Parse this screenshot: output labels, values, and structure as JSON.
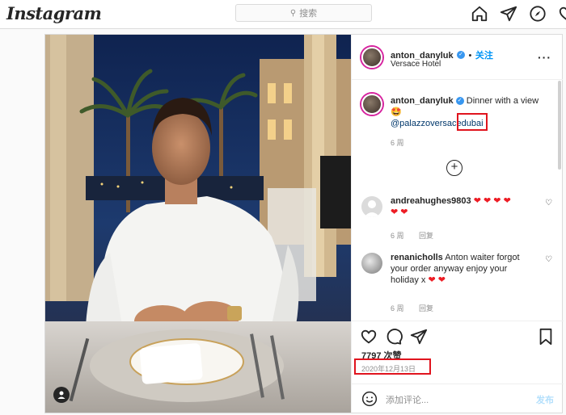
{
  "topbar": {
    "logo": "Instagram",
    "search_placeholder": "搜索",
    "icons": [
      "home-icon",
      "direct-icon",
      "explore-icon",
      "heart-icon"
    ]
  },
  "post": {
    "author": "anton_danyluk",
    "follow_label": "关注",
    "location": "Versace Hotel",
    "caption": {
      "username": "anton_danyluk",
      "text": "Dinner with a view",
      "emoji": "🤩",
      "mention_prefix": "@palazzoversace",
      "mention_highlight": "dubai",
      "time": "6 周"
    },
    "comments": [
      {
        "username": "andreahughes9803",
        "text": "",
        "hearts": 6,
        "time": "6 周",
        "reply_label": "回复"
      },
      {
        "username": "renanicholls",
        "text": "Anton waiter forgot your order anyway enjoy your holiday x",
        "hearts": 2,
        "time": "6 周",
        "reply_label": "回复"
      }
    ],
    "likes": "7797 次赞",
    "date": "2020年12月13日",
    "add_comment_placeholder": "添加评论...",
    "post_label": "发布"
  },
  "colors": {
    "accent": "#0095f6",
    "highlight_box": "#e0141e",
    "heart": "#ed1c24",
    "border": "#dbdbdb"
  }
}
